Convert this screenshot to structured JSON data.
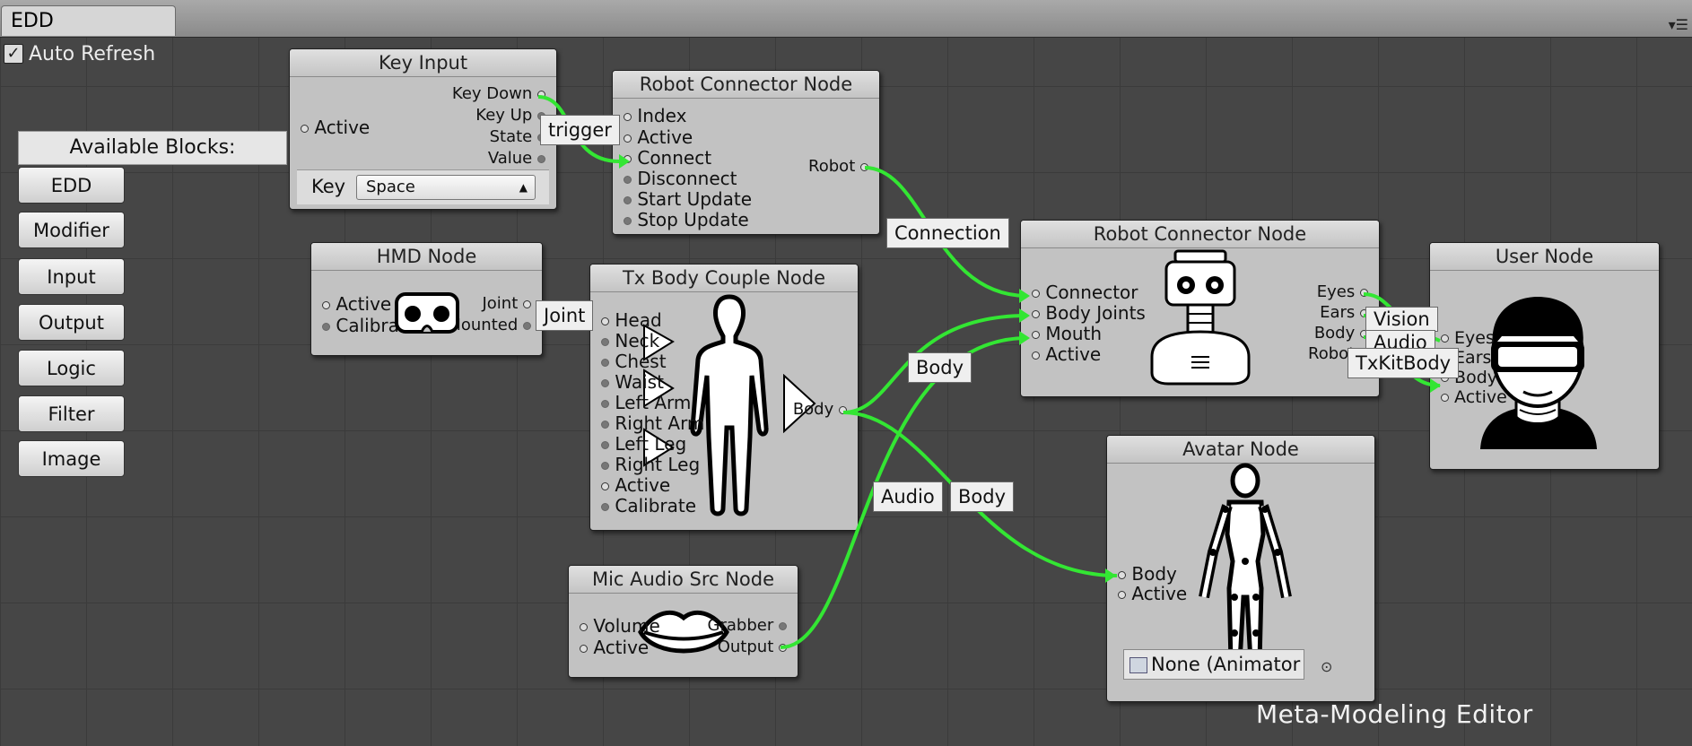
{
  "window": {
    "tab_title": "EDD",
    "menu_icon": "hamburger-icon"
  },
  "toolbar": {
    "auto_refresh_label": "Auto Refresh",
    "auto_refresh_checked": true
  },
  "sidebar": {
    "header": "Available Blocks:",
    "items": [
      "EDD",
      "Modifier",
      "Input",
      "Output",
      "Logic",
      "Filter",
      "Image"
    ]
  },
  "nodes": {
    "key_input": {
      "title": "Key Input",
      "in_ports": [
        "Active"
      ],
      "out_ports": [
        "Key Down",
        "Key Up",
        "State",
        "Value"
      ],
      "key_label": "Key",
      "key_value": "Space"
    },
    "robot_connector_1": {
      "title": "Robot Connector Node",
      "in_ports": [
        "Index",
        "Active",
        "Connect",
        "Disconnect",
        "Start Update",
        "Stop Update"
      ],
      "out_ports": [
        "Robot"
      ]
    },
    "hmd": {
      "title": "HMD Node",
      "in_ports": [
        "Active",
        "Calibrate"
      ],
      "out_ports": [
        "Joint",
        "Mounted"
      ]
    },
    "tx_body": {
      "title": "Tx Body Couple Node",
      "in_ports": [
        "Head",
        "Neck",
        "Chest",
        "Waist",
        "Left Arm",
        "Right Arm",
        "Left Leg",
        "Right Leg",
        "Active",
        "Calibrate"
      ],
      "out_ports": [
        "Body"
      ]
    },
    "robot_connector_2": {
      "title": "Robot Connector Node",
      "in_ports": [
        "Connector",
        "Body Joints",
        "Mouth",
        "Active"
      ],
      "out_ports": [
        "Eyes",
        "Ears",
        "Body",
        "Robot"
      ]
    },
    "user": {
      "title": "User Node",
      "in_ports": [
        "Eyes",
        "Ears",
        "Body",
        "Active"
      ]
    },
    "mic": {
      "title": "Mic Audio Src Node",
      "in_ports": [
        "Volume",
        "Active"
      ],
      "out_ports": [
        "Grabber",
        "Output"
      ]
    },
    "avatar": {
      "title": "Avatar Node",
      "in_ports": [
        "Body",
        "Active"
      ],
      "animator_value": "None (Animator"
    }
  },
  "wire_labels": {
    "trigger": "trigger",
    "joint": "Joint",
    "connection": "Connection",
    "body1": "Body",
    "audio": "Audio",
    "body2": "Body",
    "vision": "Vision",
    "audio2": "Audio",
    "txkitbody": "TxKitBody"
  },
  "footer": {
    "watermark": "Meta-Modeling Editor"
  },
  "colors": {
    "wire": "#33e633",
    "node_bg": "#c2c2c2",
    "canvas_bg": "#464646"
  }
}
